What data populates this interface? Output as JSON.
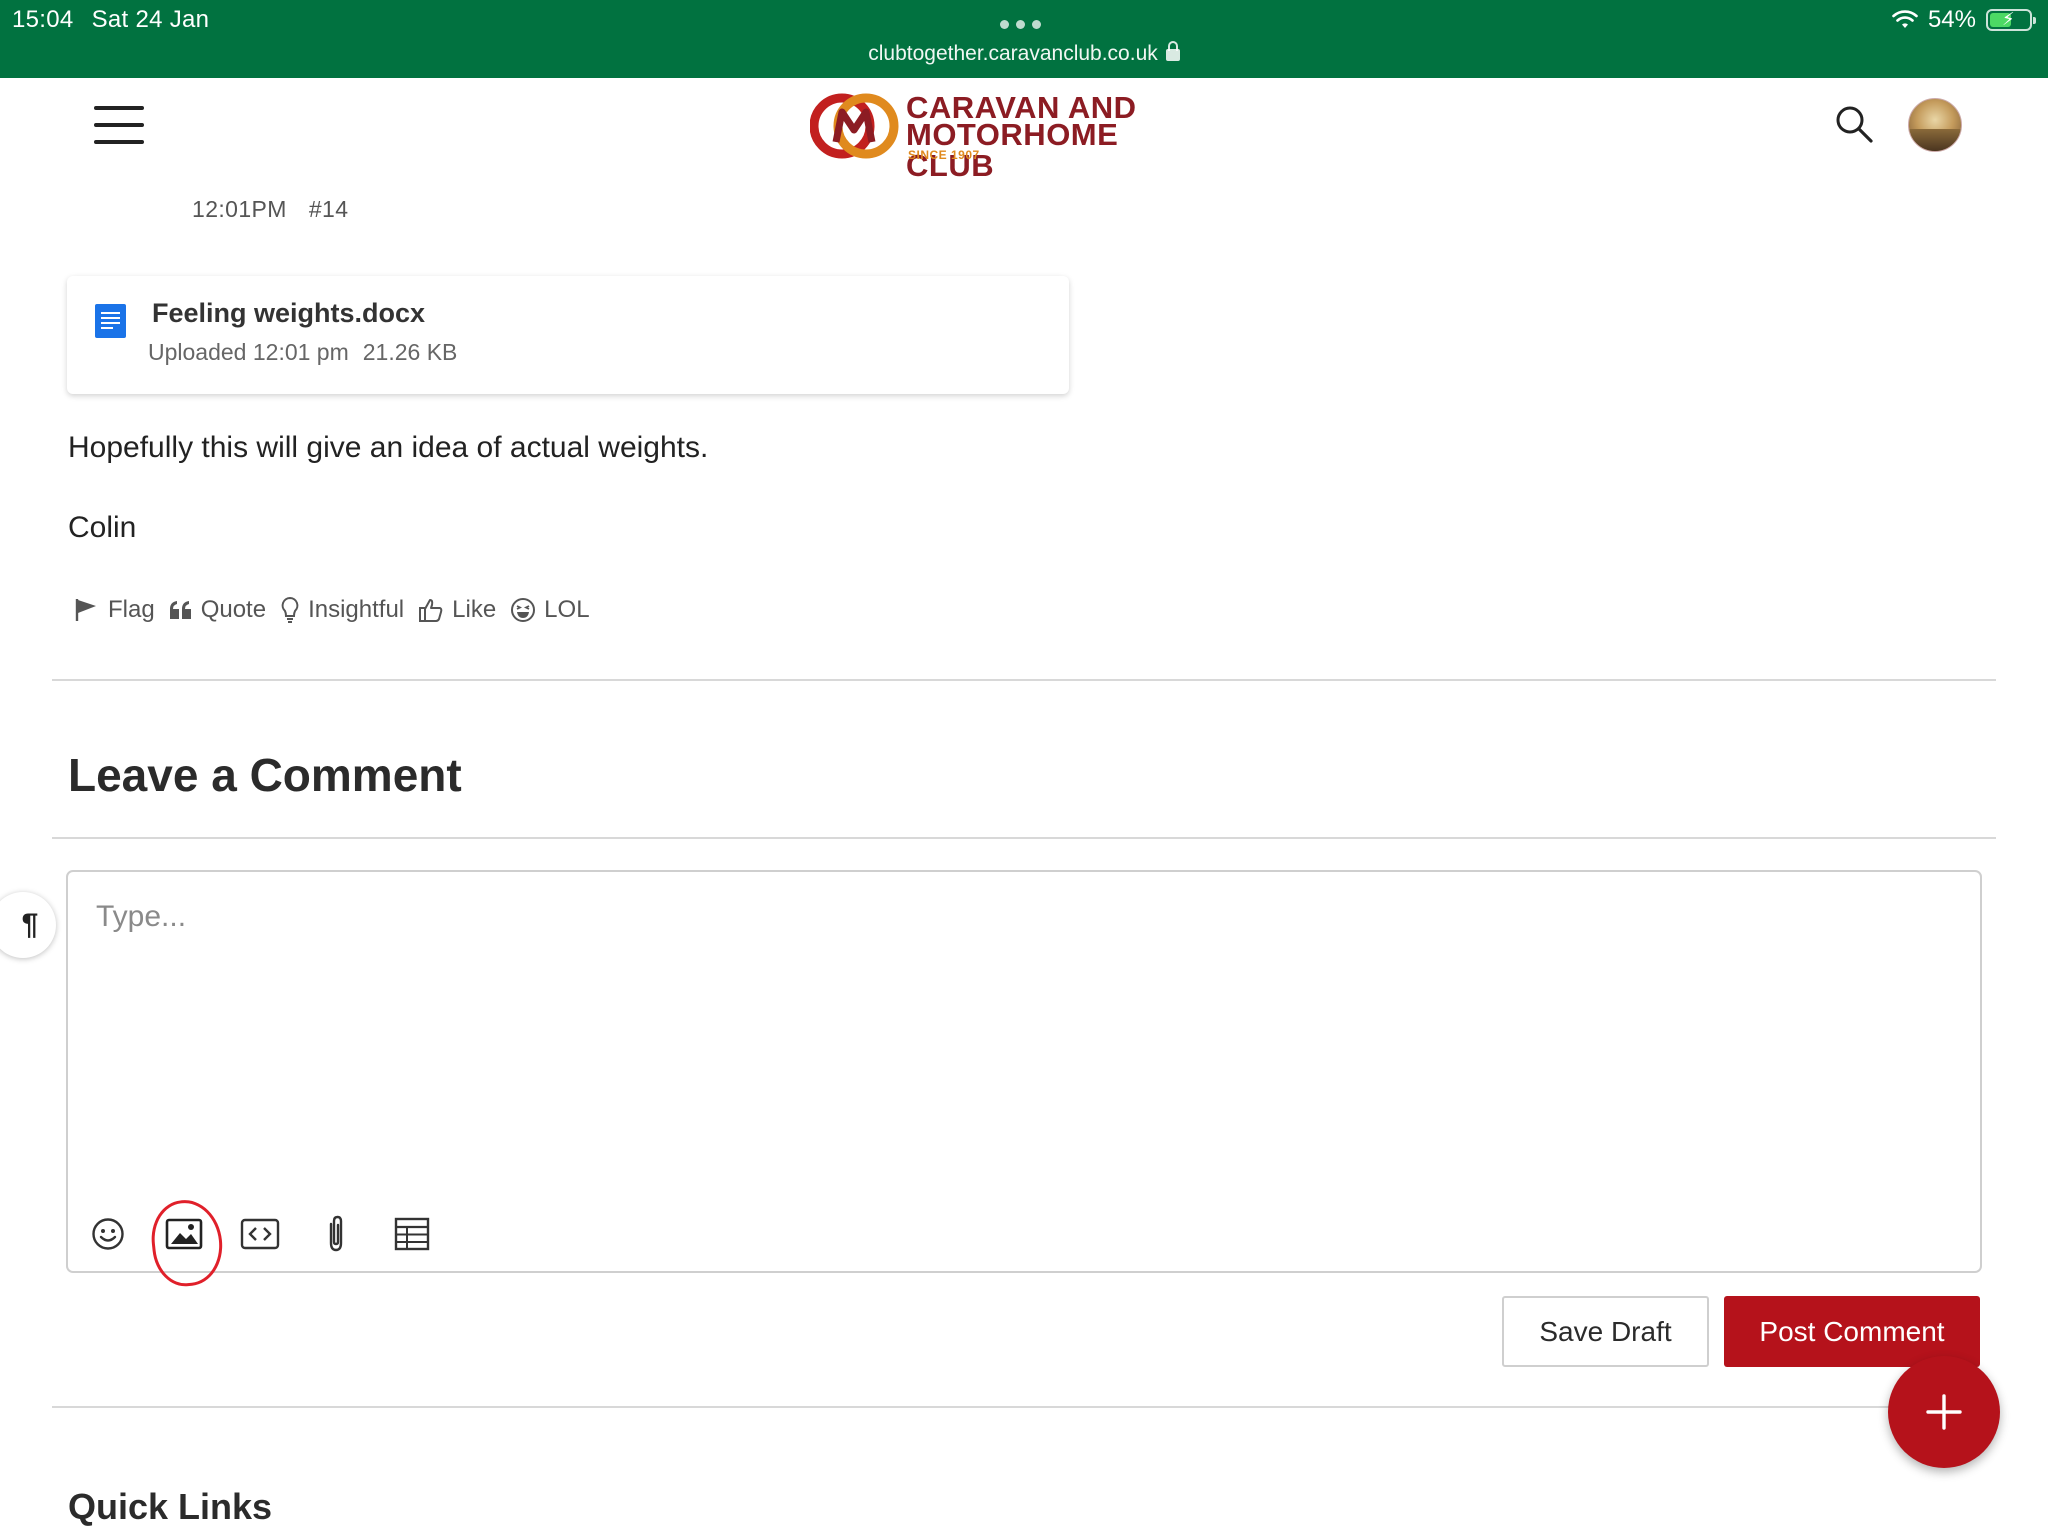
{
  "status_bar": {
    "time": "15:04",
    "date": "Sat 24 Jan",
    "url": "clubtogether.caravanclub.co.uk",
    "battery": "54%",
    "battery_level": 0.54
  },
  "header": {
    "logo_line1": "CARAVAN AND",
    "logo_line2": "MOTORHOME CLUB",
    "logo_since": "SINCE 1907"
  },
  "post": {
    "time": "12:01PM",
    "number": "#14",
    "attachment": {
      "name": "Feeling weights.docx",
      "uploaded": "Uploaded 12:01 pm",
      "size": "21.26 KB"
    },
    "body": [
      "Hopefully this will give an idea of actual weights.",
      "Colin"
    ],
    "actions": {
      "flag": "Flag",
      "quote": "Quote",
      "insightful": "Insightful",
      "like": "Like",
      "lol": "LOL"
    }
  },
  "comment": {
    "title": "Leave a Comment",
    "placeholder": "Type...",
    "paragraph_glyph": "¶",
    "save_draft": "Save Draft",
    "post_comment": "Post Comment",
    "fab": "+"
  },
  "footer": {
    "quick_links": "Quick Links"
  },
  "colors": {
    "status_bar": "#017240",
    "brand_red": "#b5121b",
    "logo_red": "#8c1c23",
    "logo_orange": "#e08a1e",
    "annotation": "#e0202a"
  }
}
